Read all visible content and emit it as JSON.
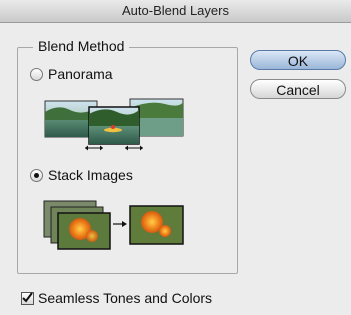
{
  "window": {
    "title": "Auto-Blend Layers"
  },
  "blend_method": {
    "title": "Blend Method",
    "options": [
      {
        "label": "Panorama",
        "selected": false
      },
      {
        "label": "Stack Images",
        "selected": true
      }
    ]
  },
  "buttons": {
    "ok_label": "OK",
    "cancel_label": "Cancel"
  },
  "seamless": {
    "label": "Seamless Tones and Colors",
    "checked": true
  }
}
